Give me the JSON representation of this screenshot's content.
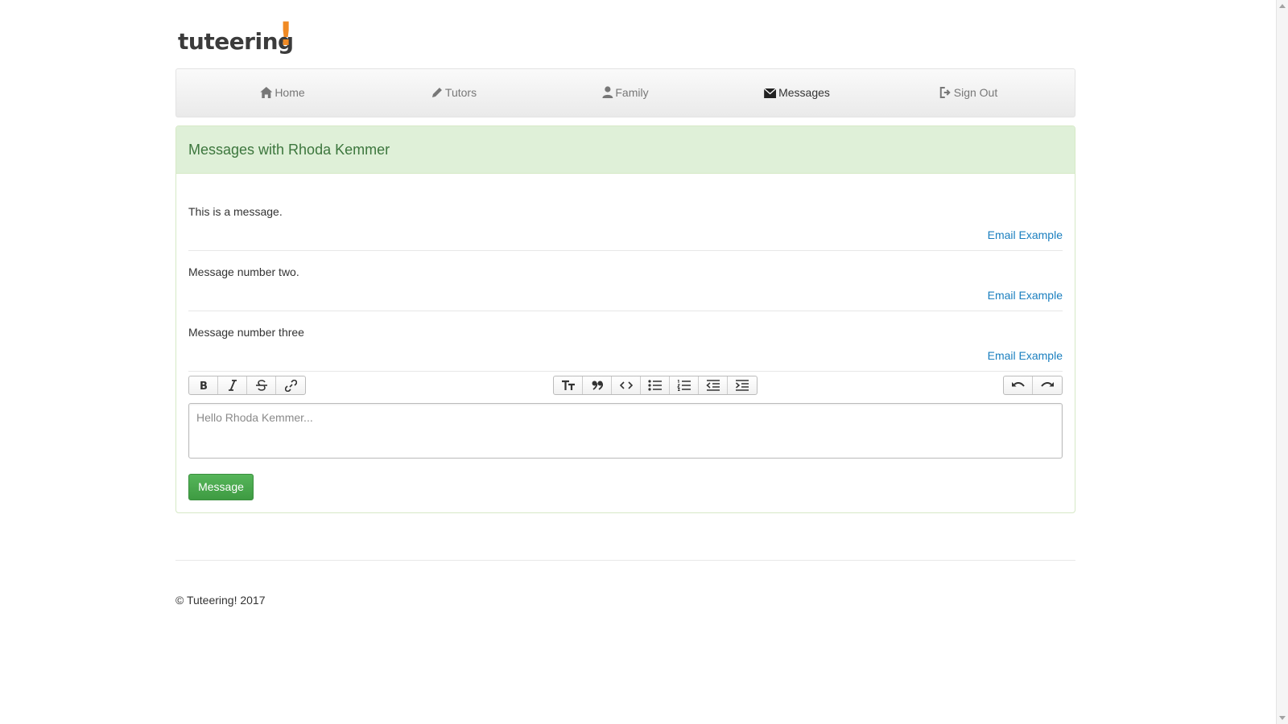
{
  "brand": {
    "word": "tuteering",
    "mark": "!"
  },
  "nav": {
    "items": [
      {
        "label": "Home",
        "icon": "home-icon"
      },
      {
        "label": "Tutors",
        "icon": "pencil-icon"
      },
      {
        "label": "Family",
        "icon": "user-icon"
      },
      {
        "label": "Messages",
        "icon": "envelope-icon",
        "active": true
      },
      {
        "label": "Sign Out",
        "icon": "sign-out-icon"
      }
    ]
  },
  "panel": {
    "title": "Messages with Rhoda Kemmer",
    "messages": [
      {
        "text": "This is a message.",
        "author": "Email Example"
      },
      {
        "text": "Message number two.",
        "author": "Email Example"
      },
      {
        "text": "Message number three",
        "author": "Email Example"
      }
    ]
  },
  "editor": {
    "placeholder": "Hello Rhoda Kemmer...",
    "toolbar": {
      "left": [
        "bold-icon",
        "italic-icon",
        "strikethrough-icon",
        "link-icon"
      ],
      "middle": [
        "heading-icon",
        "quote-icon",
        "code-icon",
        "bullet-list-icon",
        "numbered-list-icon",
        "outdent-icon",
        "indent-icon"
      ],
      "right": [
        "undo-icon",
        "redo-icon"
      ]
    }
  },
  "submit": {
    "label": "Message"
  },
  "footer": {
    "text": "© Tuteering! 2017"
  },
  "colors": {
    "accent": "#f08a24",
    "success": "#5cb85c",
    "panel_heading": "#dff0d8",
    "link": "#1a7fbf"
  }
}
